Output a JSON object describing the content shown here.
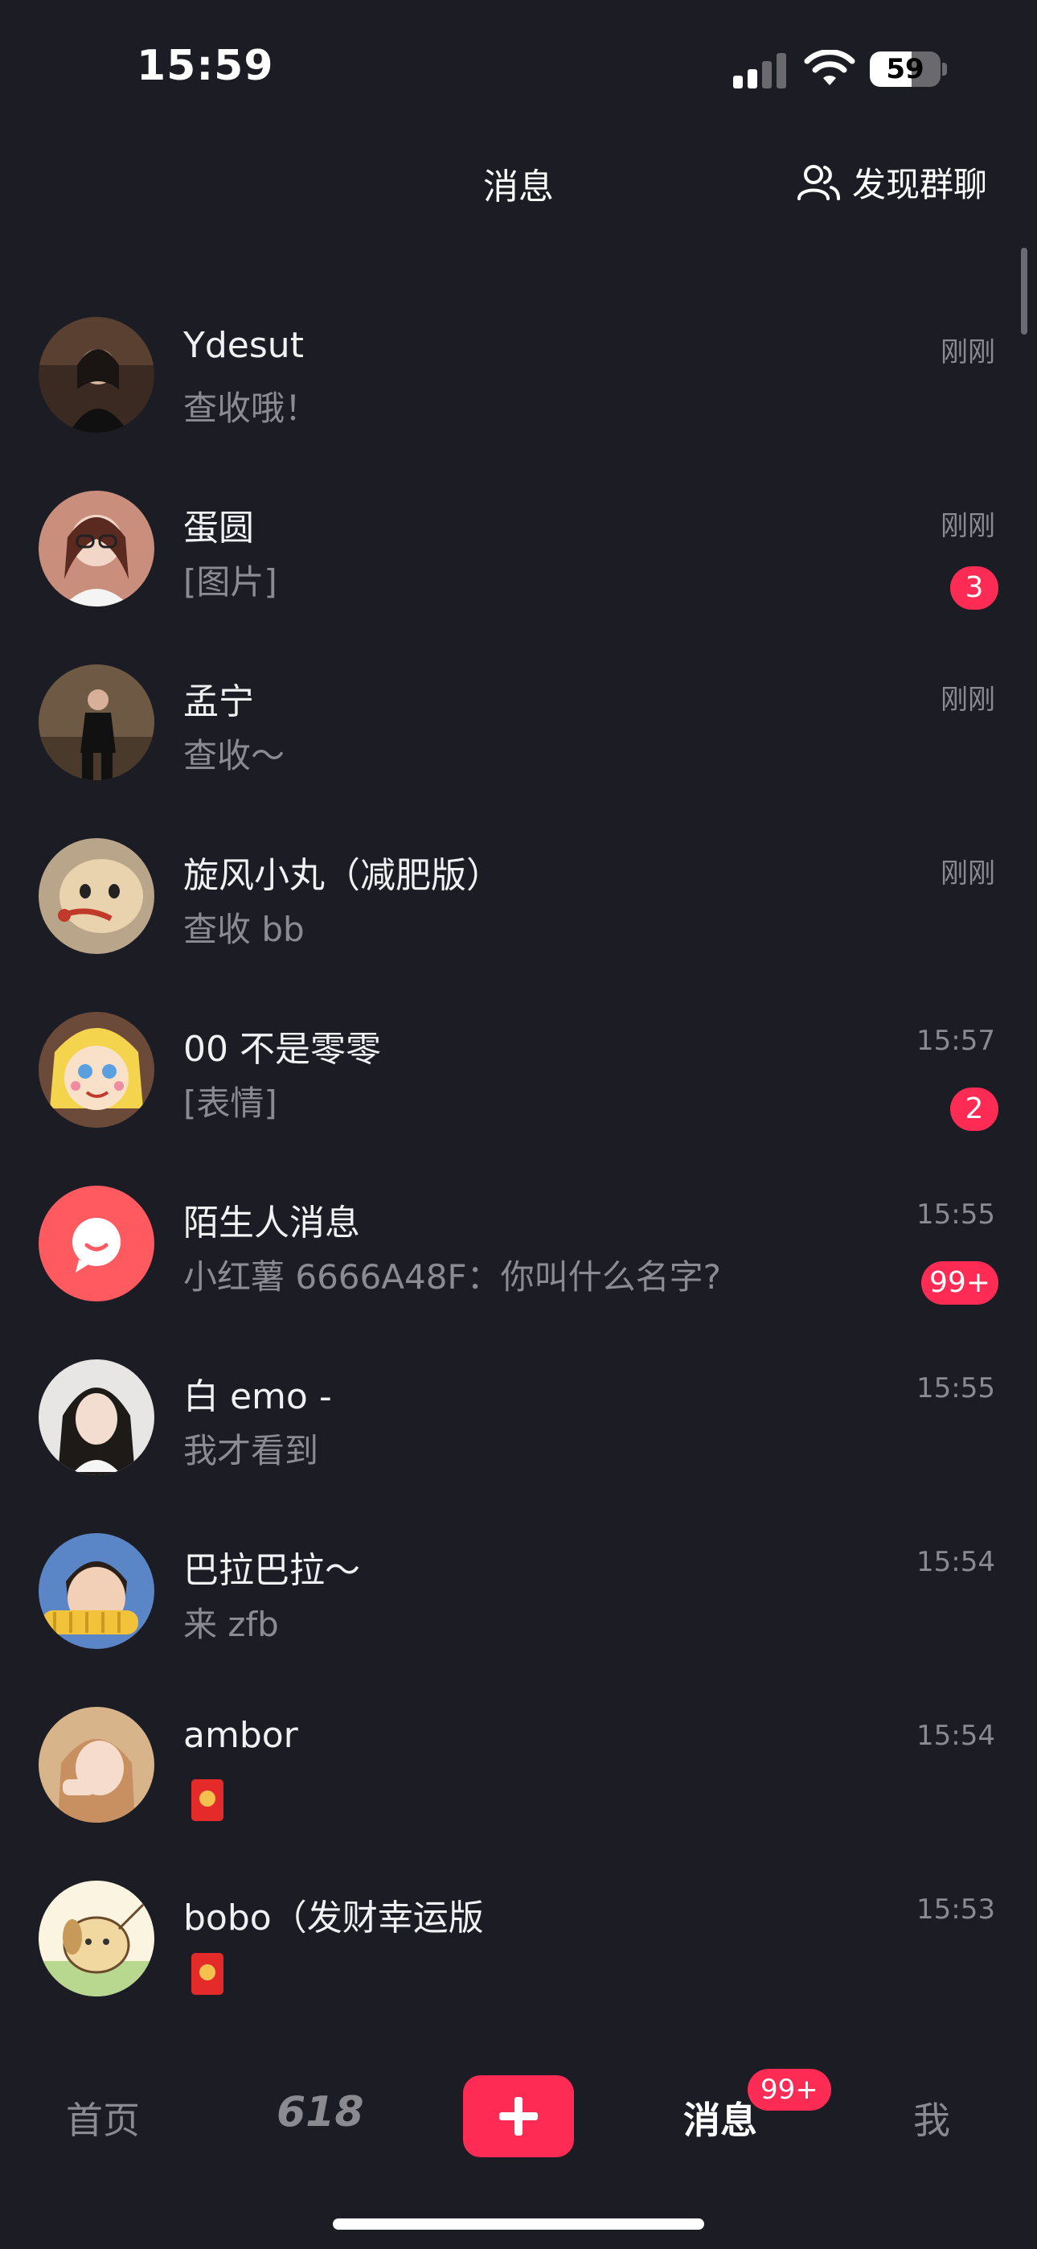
{
  "status_bar": {
    "time": "15:59",
    "battery": "59",
    "battery_level": 0.59
  },
  "header": {
    "title": "消息",
    "discover_label": "发现群聊"
  },
  "conversations": [
    {
      "name": "Ydesut",
      "preview": "查收哦！",
      "time": "刚刚",
      "badge": null
    },
    {
      "name": "蛋圆",
      "preview": "[图片]",
      "time": "刚刚",
      "badge": "3"
    },
    {
      "name": "孟宁",
      "preview": "查收～",
      "time": "刚刚",
      "badge": null
    },
    {
      "name": "旋风小丸（减肥版）",
      "preview": "查收 bb",
      "time": "刚刚",
      "badge": null
    },
    {
      "name": "00 不是零零",
      "preview": "[表情]",
      "time": "15:57",
      "badge": "2"
    },
    {
      "name": "陌生人消息",
      "preview": "小红薯 6666A48F：你叫什么名字?",
      "time": "15:55",
      "badge": "99+"
    },
    {
      "name": "白 emo -",
      "preview": "我才看到",
      "time": "15:55",
      "badge": null
    },
    {
      "name": "巴拉巴拉～",
      "preview": "来 zfb",
      "time": "15:54",
      "badge": null
    },
    {
      "name": "ambor",
      "preview": "",
      "time": "15:54",
      "badge": null
    },
    {
      "name": "bobo（发财幸运版",
      "preview": "",
      "time": "15:53",
      "badge": null
    }
  ],
  "tabbar": {
    "home": "首页",
    "promo": "618",
    "messages": "消息",
    "messages_badge": "99+",
    "me": "我"
  },
  "colors": {
    "accent": "#fe2c55",
    "background": "#1c1c24"
  }
}
